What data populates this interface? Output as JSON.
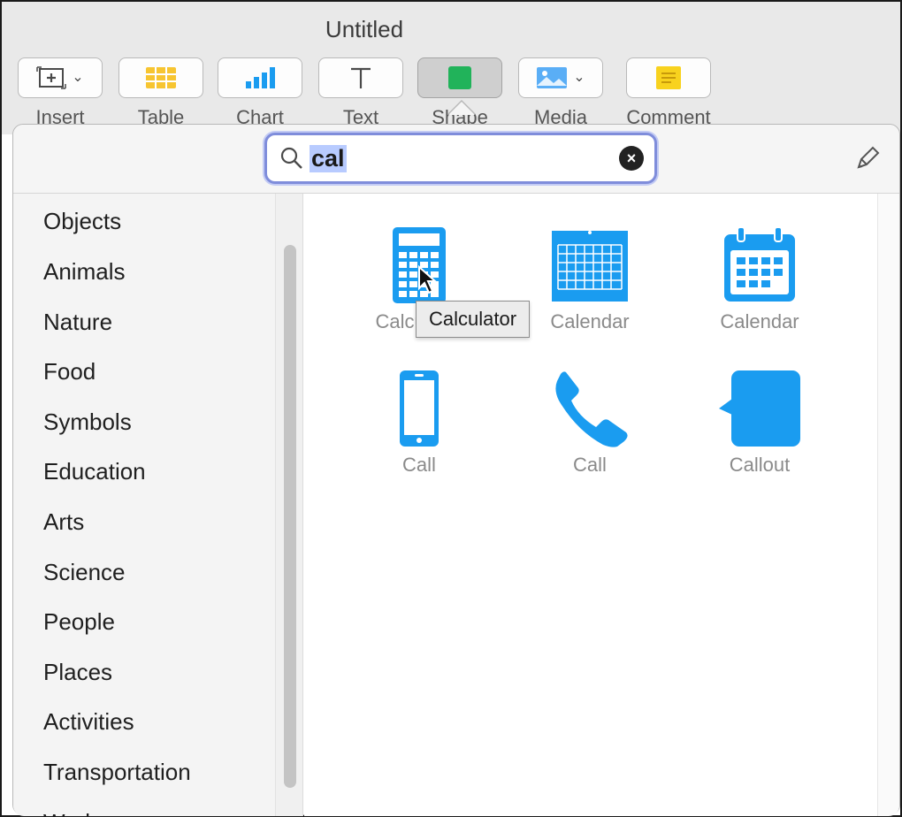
{
  "window": {
    "title": "Untitled"
  },
  "toolbar": {
    "buttons": [
      {
        "id": "insert",
        "label": "Insert",
        "icon": "insert-plus-icon",
        "has_menu": true
      },
      {
        "id": "table",
        "label": "Table",
        "icon": "table-icon",
        "has_menu": false
      },
      {
        "id": "chart",
        "label": "Chart",
        "icon": "chart-icon",
        "has_menu": false
      },
      {
        "id": "text",
        "label": "Text",
        "icon": "text-icon",
        "has_menu": false
      },
      {
        "id": "shape",
        "label": "Shape",
        "icon": "shape-square-icon",
        "has_menu": false,
        "active": true
      },
      {
        "id": "media",
        "label": "Media",
        "icon": "media-image-icon",
        "has_menu": true
      },
      {
        "id": "comment",
        "label": "Comment",
        "icon": "comment-note-icon",
        "has_menu": false
      }
    ]
  },
  "search": {
    "value": "cal",
    "placeholder": ""
  },
  "categories": [
    "Objects",
    "Animals",
    "Nature",
    "Food",
    "Symbols",
    "Education",
    "Arts",
    "Science",
    "People",
    "Places",
    "Activities",
    "Transportation",
    "Work"
  ],
  "shapes": [
    {
      "label": "Calculator",
      "icon": "calculator-icon"
    },
    {
      "label": "Calendar",
      "icon": "calendar-grid-icon"
    },
    {
      "label": "Calendar",
      "icon": "calendar-rings-icon"
    },
    {
      "label": "Call",
      "icon": "mobile-phone-icon"
    },
    {
      "label": "Call",
      "icon": "phone-handset-icon"
    },
    {
      "label": "Callout",
      "icon": "speech-bubble-icon"
    }
  ],
  "tooltip": {
    "text": "Calculator"
  },
  "colors": {
    "shape_blue": "#1a9cf0",
    "table_yellow": "#f7c531",
    "shape_green": "#21b35a",
    "comment_yellow": "#f8d21e",
    "search_focus": "#7f8ddb"
  }
}
